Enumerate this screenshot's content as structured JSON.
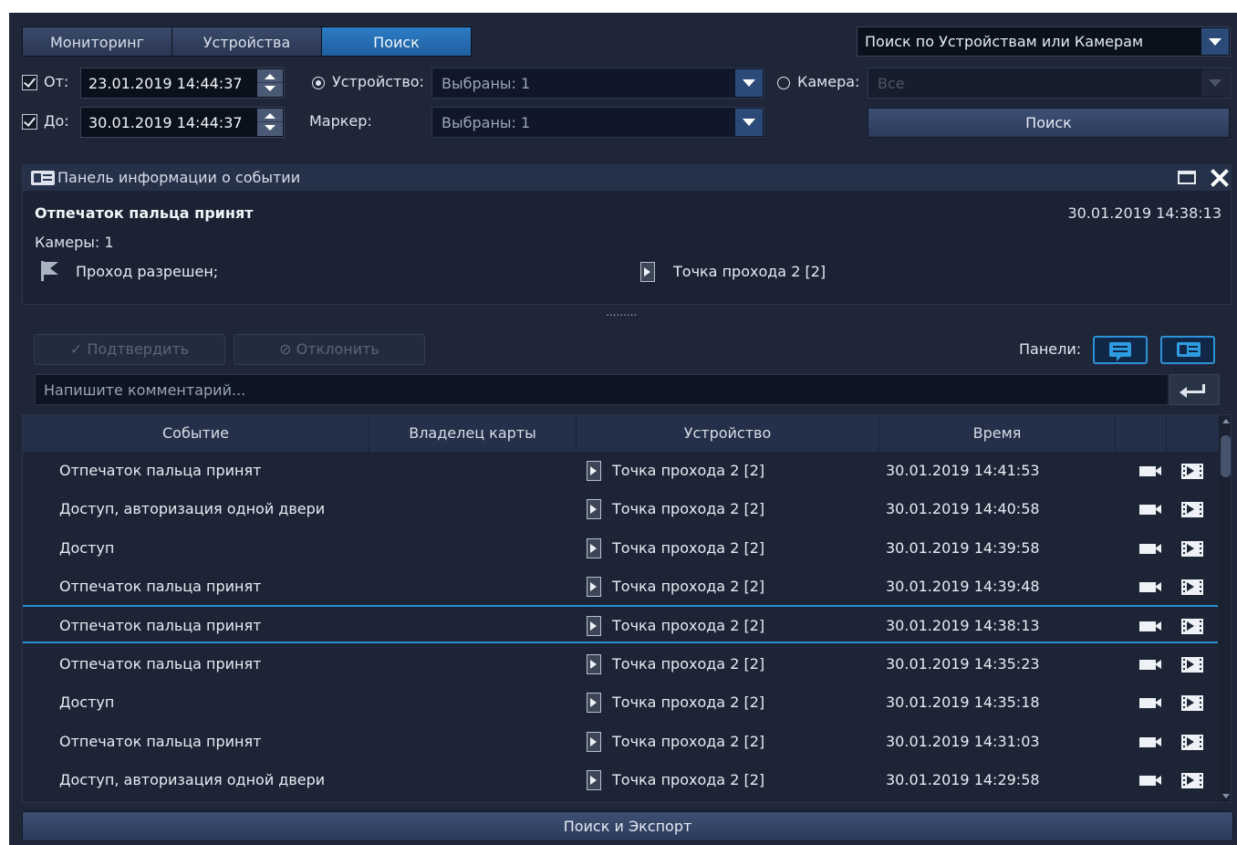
{
  "tabs": [
    {
      "label": "Мониторинг",
      "active": false
    },
    {
      "label": "Устройства",
      "active": false
    },
    {
      "label": "Поиск",
      "active": true
    }
  ],
  "search_mode": {
    "value": "Поиск по Устройствам или Камерам"
  },
  "filters": {
    "from_label": "От:",
    "from_value": "23.01.2019 14:44:37",
    "to_label": "До:",
    "to_value": "30.01.2019 14:44:37",
    "device_label": "Устройство:",
    "device_value": "Выбраны: 1",
    "camera_label": "Камера:",
    "camera_value": "Все",
    "marker_label": "Маркер:",
    "marker_value": "Выбраны: 1",
    "search_button": "Поиск"
  },
  "info_panel": {
    "title": "Панель информации о событии",
    "event_title": "Отпечаток пальца принят",
    "event_time": "30.01.2019 14:38:13",
    "cameras": "Камеры: 1",
    "flag_text": "Проход разрешен;",
    "access_point": "Точка прохода 2 [2]",
    "splitter": "........."
  },
  "actions": {
    "confirm": "✓ Подтвердить",
    "reject": "⊘ Отклонить",
    "panels_label": "Панели:",
    "comment_placeholder": "Напишите комментарий..."
  },
  "table": {
    "columns": [
      "Событие",
      "Владелец карты",
      "Устройство",
      "Время"
    ],
    "rows": [
      {
        "event": "Отпечаток пальца принят",
        "owner": "",
        "device": "Точка прохода 2 [2]",
        "time": "30.01.2019 14:41:53",
        "selected": false
      },
      {
        "event": "Доступ, авторизация одной двери",
        "owner": "",
        "device": "Точка прохода 2 [2]",
        "time": "30.01.2019 14:40:58",
        "selected": false
      },
      {
        "event": "Доступ",
        "owner": "",
        "device": "Точка прохода 2 [2]",
        "time": "30.01.2019 14:39:58",
        "selected": false
      },
      {
        "event": "Отпечаток пальца принят",
        "owner": "",
        "device": "Точка прохода 2 [2]",
        "time": "30.01.2019 14:39:48",
        "selected": false
      },
      {
        "event": "Отпечаток пальца принят",
        "owner": "",
        "device": "Точка прохода 2 [2]",
        "time": "30.01.2019 14:38:13",
        "selected": true
      },
      {
        "event": "Отпечаток пальца принят",
        "owner": "",
        "device": "Точка прохода 2 [2]",
        "time": "30.01.2019 14:35:23",
        "selected": false
      },
      {
        "event": "Доступ",
        "owner": "",
        "device": "Точка прохода 2 [2]",
        "time": "30.01.2019 14:35:18",
        "selected": false
      },
      {
        "event": "Отпечаток пальца принят",
        "owner": "",
        "device": "Точка прохода 2 [2]",
        "time": "30.01.2019 14:31:03",
        "selected": false
      },
      {
        "event": "Доступ, авторизация одной двери",
        "owner": "",
        "device": "Точка прохода 2 [2]",
        "time": "30.01.2019 14:29:58",
        "selected": false
      }
    ]
  },
  "footer": {
    "export_button": "Поиск и Экспорт"
  },
  "colors": {
    "background": "#1e2637",
    "accent": "#2891d6",
    "active_tab": "#2c7cc6"
  }
}
